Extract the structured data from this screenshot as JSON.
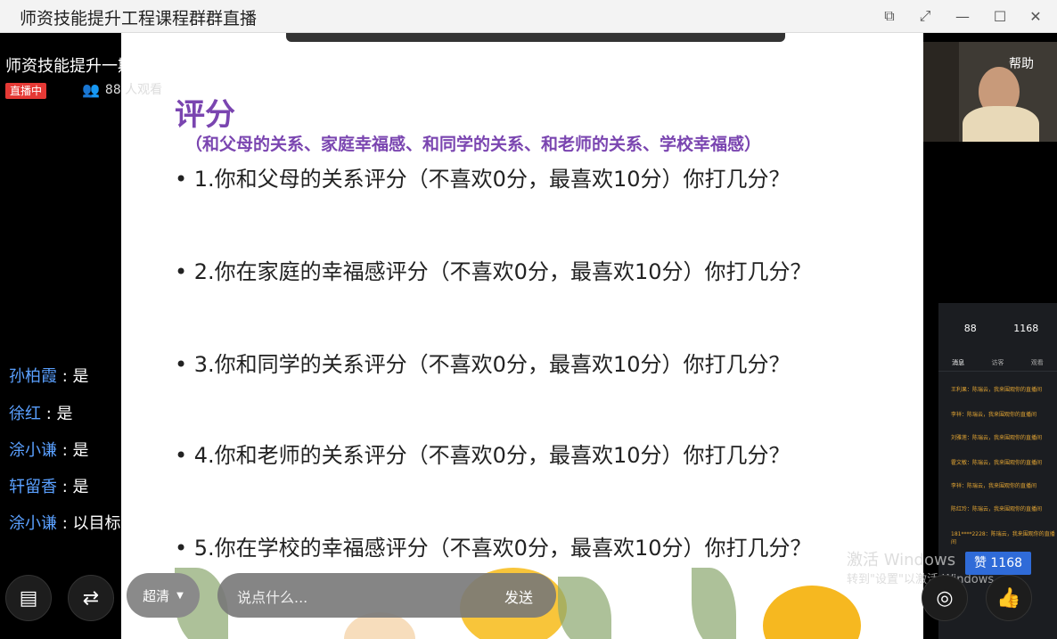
{
  "window": {
    "title": "师资技能提升工程课程群群直播"
  },
  "live": {
    "title": "师资技能提升一期班：中小学生团体心理普查及档案的建立",
    "badge": "直播中",
    "viewers": "88 人观看"
  },
  "slide": {
    "heading": "评分",
    "subheading": "（和父母的关系、家庭幸福感、和同学的关系、和老师的关系、学校幸福感）",
    "questions": [
      "• 1.你和父母的关系评分（不喜欢0分，最喜欢10分）你打几分？",
      "• 2.你在家庭的幸福感评分（不喜欢0分，最喜欢10分）你打几分？",
      "• 3.你和同学的关系评分（不喜欢0分，最喜欢10分）你打几分？",
      "• 4.你和老师的关系评分（不喜欢0分，最喜欢10分）你打几分？",
      "• 5.你在学校的幸福感评分（不喜欢0分，最喜欢10分）你打几分？"
    ]
  },
  "chat": [
    {
      "name": "孙柏霞",
      "msg": " : 是"
    },
    {
      "name": "徐红",
      "msg": " : 是"
    },
    {
      "name": "涂小谦",
      "msg": " : 是"
    },
    {
      "name": "轩留香",
      "msg": " : 是"
    },
    {
      "name": "涂小谦",
      "msg": " : 以目标为导向"
    }
  ],
  "controls": {
    "quality": "超清",
    "input_placeholder": "说点什么...",
    "send": "发送",
    "like": "赞 1168"
  },
  "pip": {
    "help": "帮助"
  },
  "panel": {
    "stat1": "88",
    "stat2": "1168",
    "tabs": [
      "消息",
      "访客",
      "观看"
    ],
    "lines": [
      "王利果：陈瑞云，我来围观你的直播间",
      "李祥：陈瑞云，我来围观你的直播间",
      "刘雅莲：陈瑞云，我来围观你的直播间",
      "霍文敏：陈瑞云，我来围观你的直播间",
      "李祥：陈瑞云，我来围观你的直播间",
      "陈红玲：陈瑞云，我来围观你的直播间",
      "181****2228：陈瑞云，我来围观你的直播间"
    ]
  },
  "watermark": {
    "line1": "激活 Windows",
    "line2": "转到\"设置\"以激活 Windows。"
  }
}
